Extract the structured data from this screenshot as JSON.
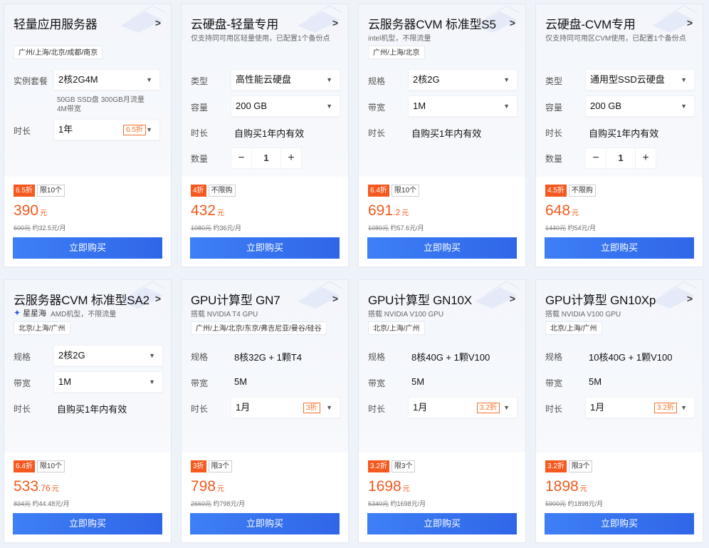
{
  "cards": [
    {
      "title": "轻量应用服务器",
      "tag": "广州/上海/北京/成都/南京",
      "rows": [
        {
          "label": "实例套餐",
          "value": "2核2G4M"
        },
        {
          "label": "时长",
          "value": "1年",
          "discount": "6.5折"
        }
      ],
      "note_line1": "50GB SSD盘 300GB月流量",
      "note_line2": "4M带宽",
      "badge_discount": "6.5折",
      "badge_limit": "限10个",
      "price_int": "390",
      "price_dec": "",
      "price_unit": "元",
      "original": "600元",
      "monthly": "约32.5元/月",
      "buy_label": "立即购买"
    },
    {
      "title": "云硬盘-轻量专用",
      "subtitle": "仅支持同可用区轻量使用，已配置1个备份点",
      "rows": [
        {
          "label": "类型",
          "value": "高性能云硬盘"
        },
        {
          "label": "容量",
          "value": "200 GB"
        },
        {
          "label": "时长",
          "value": "自购买1年内有效"
        },
        {
          "label": "数量",
          "value": "1"
        }
      ],
      "badge_discount": "4折",
      "badge_limit": "不限购",
      "price_int": "432",
      "price_dec": "",
      "price_unit": "元",
      "original": "1080元",
      "monthly": "约36元/月",
      "buy_label": "立即购买"
    },
    {
      "title": "云服务器CVM 标准型S5",
      "subtitle": "intel机型，不限流量",
      "tag": "广州/上海/北京",
      "rows": [
        {
          "label": "规格",
          "value": "2核2G"
        },
        {
          "label": "带宽",
          "value": "1M"
        },
        {
          "label": "时长",
          "value": "自购买1年内有效"
        }
      ],
      "badge_discount": "6.4折",
      "badge_limit": "限10个",
      "price_int": "691",
      "price_dec": ".2",
      "price_unit": "元",
      "original": "1080元",
      "monthly": "约57.6元/月",
      "buy_label": "立即购买"
    },
    {
      "title": "云硬盘-CVM专用",
      "subtitle": "仅支持同可用区CVM使用，已配置1个备份点",
      "rows": [
        {
          "label": "类型",
          "value": "通用型SSD云硬盘"
        },
        {
          "label": "容量",
          "value": "200 GB"
        },
        {
          "label": "时长",
          "value": "自购买1年内有效"
        },
        {
          "label": "数量",
          "value": "1"
        }
      ],
      "badge_discount": "4.5折",
      "badge_limit": "不限购",
      "price_int": "648",
      "price_dec": "",
      "price_unit": "元",
      "original": "1440元",
      "monthly": "约54元/月",
      "buy_label": "立即购买"
    },
    {
      "title": "云服务器CVM 标准型SA2",
      "brand": "星星海",
      "subtitle": "AMD机型，不限流量",
      "tag": "北京/上海/广州",
      "rows": [
        {
          "label": "规格",
          "value": "2核2G"
        },
        {
          "label": "带宽",
          "value": "1M"
        },
        {
          "label": "时长",
          "value": "自购买1年内有效"
        }
      ],
      "badge_discount": "6.4折",
      "badge_limit": "限10个",
      "price_int": "533",
      "price_dec": ".76",
      "price_unit": "元",
      "original": "834元",
      "monthly": "约44.48元/月",
      "buy_label": "立即购买"
    },
    {
      "title": "GPU计算型 GN7",
      "subtitle": "搭载 NVIDIA T4 GPU",
      "tag": "广州/上海/北京/东京/弗吉尼亚/曼谷/硅谷",
      "rows": [
        {
          "label": "规格",
          "value": "8核32G + 1颗T4"
        },
        {
          "label": "带宽",
          "value": "5M"
        },
        {
          "label": "时长",
          "value": "1月",
          "discount": "3折"
        }
      ],
      "badge_discount": "3折",
      "badge_limit": "限3个",
      "price_int": "798",
      "price_dec": "",
      "price_unit": "元",
      "original": "2660元",
      "monthly": "约798元/月",
      "buy_label": "立即购买"
    },
    {
      "title": "GPU计算型 GN10X",
      "subtitle": "搭载 NVIDIA V100 GPU",
      "tag": "北京/上海/广州",
      "rows": [
        {
          "label": "规格",
          "value": "8核40G + 1颗V100"
        },
        {
          "label": "带宽",
          "value": "5M"
        },
        {
          "label": "时长",
          "value": "1月",
          "discount": "3.2折"
        }
      ],
      "badge_discount": "3.2折",
      "badge_limit": "限3个",
      "price_int": "1698",
      "price_dec": "",
      "price_unit": "元",
      "original": "5340元",
      "monthly": "约1698元/月",
      "buy_label": "立即购买"
    },
    {
      "title": "GPU计算型 GN10Xp",
      "subtitle": "搭载 NVIDIA V100 GPU",
      "tag": "北京/上海/广州",
      "rows": [
        {
          "label": "规格",
          "value": "10核40G + 1颗V100"
        },
        {
          "label": "带宽",
          "value": "5M"
        },
        {
          "label": "时长",
          "value": "1月",
          "discount": "3.2折"
        }
      ],
      "badge_discount": "3.2折",
      "badge_limit": "限3个",
      "price_int": "1898",
      "price_dec": "",
      "price_unit": "元",
      "original": "5900元",
      "monthly": "约1898元/月",
      "buy_label": "立即购买"
    }
  ],
  "icons": {
    "arrow": "chevron-right-icon",
    "caret": "caret-down-icon",
    "brand_logo": "star-logo-icon"
  },
  "colors": {
    "accent_orange": "#f05a1e",
    "button_blue": "#3370ff"
  }
}
